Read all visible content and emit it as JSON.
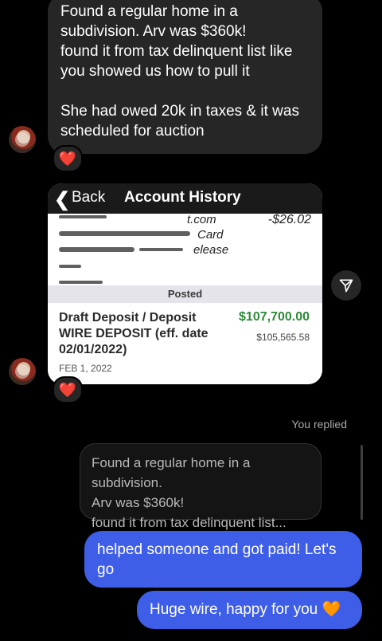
{
  "thread": {
    "received_message": {
      "lines": [
        "Found a regular home in a",
        "subdivision. Arv was $360k!",
        "found it from tax delinquent list like",
        "you showed us how to pull it",
        "",
        "She had owed 20k in taxes & it was",
        "scheduled for auction"
      ],
      "reaction": "❤️"
    },
    "shared_screenshot": {
      "back_label": "Back",
      "title": "Account History",
      "pending_amount": "-$26.02",
      "pending_fragments": [
        "t.com",
        "Card",
        "elease"
      ],
      "posted_label": "Posted",
      "transaction": {
        "description": "Draft Deposit / Deposit WIRE DEPOSIT (eff. date 02/01/2022)",
        "amount": "$107,700.00",
        "balance": "$105,565.58",
        "date": "FEB 1, 2022"
      },
      "reaction": "❤️"
    },
    "reply_indicator": "You replied",
    "quoted_message": {
      "lines": [
        "Found a regular home in a subdivision.",
        "Arv was $360k!",
        "found it from tax delinquent list... more"
      ]
    },
    "sent_messages": [
      "helped someone and got paid! Let's go",
      "Huge wire, happy for you 🧡"
    ]
  },
  "colors": {
    "background": "#000000",
    "incoming_bubble": "#262626",
    "outgoing_bubble": "#3f5ee8",
    "deposit_green": "#2d8a37",
    "heart": "#e5262e"
  },
  "icons": [
    "chevron-left-icon",
    "send-arrow-icon",
    "heart-icon",
    "avatar"
  ]
}
